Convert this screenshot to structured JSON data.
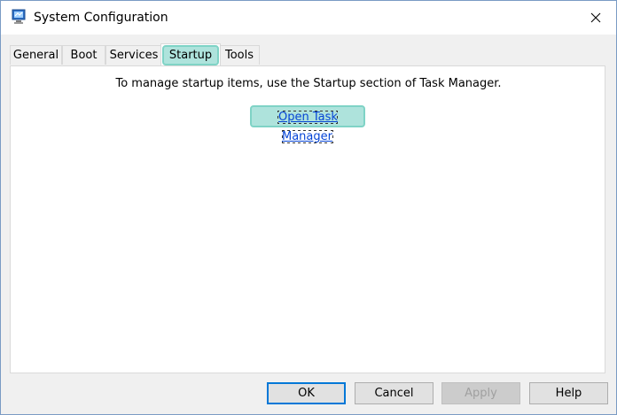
{
  "window": {
    "title": "System Configuration"
  },
  "tabs": [
    {
      "label": "General"
    },
    {
      "label": "Boot"
    },
    {
      "label": "Services"
    },
    {
      "label": "Startup"
    },
    {
      "label": "Tools"
    }
  ],
  "active_tab": "Startup",
  "startup_panel": {
    "info_text": "To manage startup items, use the Startup section of Task Manager.",
    "link_text": "Open Task Manager"
  },
  "buttons": {
    "ok": "OK",
    "cancel": "Cancel",
    "apply": "Apply",
    "help": "Help"
  },
  "icons": {
    "app": "msconfig-icon",
    "close": "close-icon"
  },
  "colors": {
    "highlight": "#aee3dc",
    "link": "#0645d6",
    "default_button_border": "#0078d7"
  }
}
